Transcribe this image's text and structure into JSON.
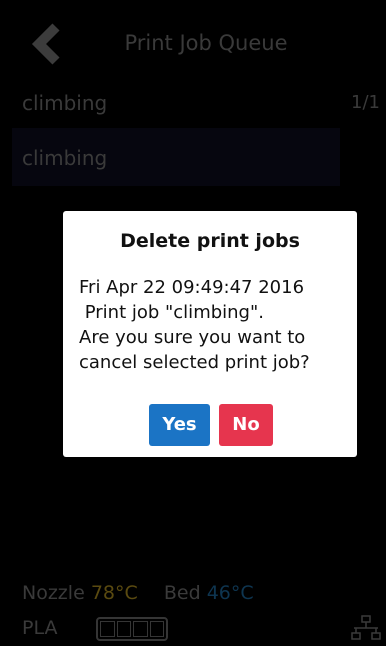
{
  "header": {
    "title": "Print Job Queue",
    "back_icon": "chevron-left-icon"
  },
  "queue": {
    "job_name": "climbing",
    "page_indicator": "1/1",
    "selected_job": "climbing"
  },
  "dialog": {
    "title": "Delete print jobs",
    "message": "Fri Apr 22 09:49:47 2016\n Print job \"climbing\".\nAre you sure you want to\ncancel selected print job?",
    "yes_label": "Yes",
    "no_label": "No"
  },
  "status": {
    "nozzle_label": "Nozzle",
    "nozzle_temp": "78°C",
    "bed_label": "Bed",
    "bed_temp": "46°C",
    "material": "PLA",
    "filament_icon": "spool-level-icon",
    "network_icon": "network-icon"
  },
  "colors": {
    "yes_button": "#1b74c5",
    "no_button": "#e6354e",
    "nozzle_temp": "#5a4a10",
    "bed_temp": "#0e3550"
  }
}
